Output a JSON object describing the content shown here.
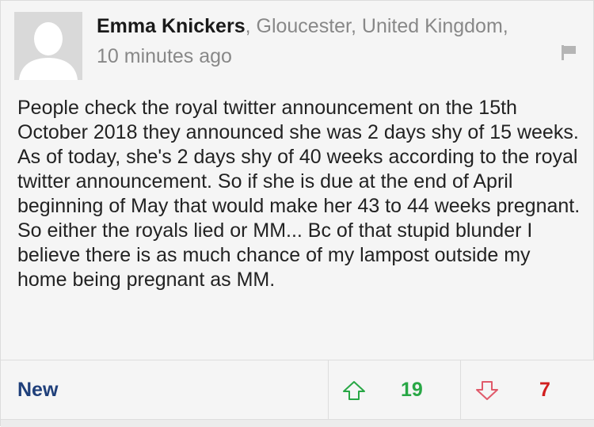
{
  "comment": {
    "author_name": "Emma Knickers",
    "author_location": ", Gloucester, United Kingdom,",
    "timestamp": "10 minutes ago",
    "body": "People check the royal twitter announcement on the 15th October 2018 they announced she was 2 days shy of 15 weeks. As of today, she's 2 days shy of 40 weeks according to the royal twitter announcement. So if she is due at the end of April beginning of May that would make her 43 to 44 weeks pregnant. So either the royals lied or MM... Bc of that stupid blunder I believe there is as much chance of my lampost outside my home being pregnant as MM."
  },
  "footer": {
    "new_label": "New",
    "upvotes": "19",
    "downvotes": "7"
  },
  "icons": {
    "avatar": "user-silhouette-icon",
    "flag": "flag-icon",
    "upvote": "arrow-up-outline-icon",
    "downvote": "arrow-down-outline-icon"
  },
  "colors": {
    "new_link": "#1f3f7a",
    "upvote": "#28a745",
    "downvote": "#d11f1f",
    "author_name": "#1a1a1a",
    "meta": "#888888"
  }
}
